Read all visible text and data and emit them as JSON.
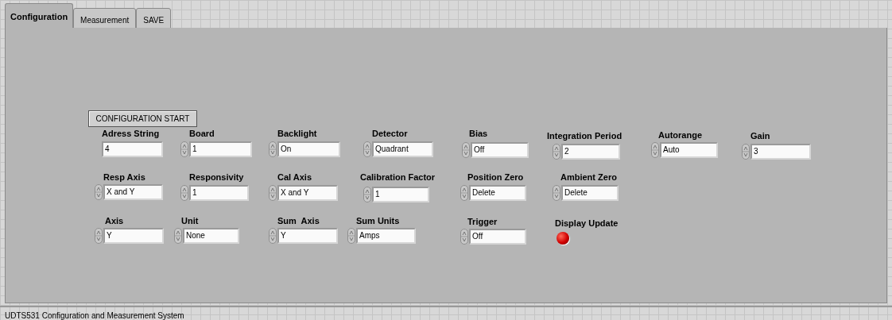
{
  "tabs": [
    {
      "label": "Configuration",
      "selected": true
    },
    {
      "label": "Measurement",
      "selected": false
    },
    {
      "label": "SAVE",
      "selected": false
    }
  ],
  "start_button": "CONFIGURATION START",
  "controls": [
    {
      "kind": "string",
      "label": "Adress String",
      "value": "4"
    },
    {
      "kind": "ring",
      "label": "Board",
      "value": "1"
    },
    {
      "kind": "ring",
      "label": "Backlight",
      "value": "On"
    },
    {
      "kind": "ring",
      "label": "Detector",
      "value": "Quadrant"
    },
    {
      "kind": "ring",
      "label": "Bias",
      "value": "Off"
    },
    {
      "kind": "ring",
      "label": "Integration Period",
      "value": "2"
    },
    {
      "kind": "ring",
      "label": "Autorange",
      "value": "Auto"
    },
    {
      "kind": "ring",
      "label": "Gain",
      "value": "3"
    },
    {
      "kind": "ring",
      "label": "Resp Axis",
      "value": "X and Y"
    },
    {
      "kind": "ring",
      "label": "Responsivity",
      "value": "1"
    },
    {
      "kind": "ring",
      "label": "Cal Axis",
      "value": "X and Y"
    },
    {
      "kind": "ring",
      "label": "Calibration Factor",
      "value": "1"
    },
    {
      "kind": "ring",
      "label": "Position Zero",
      "value": "Delete"
    },
    {
      "kind": "ring",
      "label": "Ambient Zero",
      "value": "Delete"
    },
    {
      "kind": "ring",
      "label": "Axis",
      "value": "Y"
    },
    {
      "kind": "ring",
      "label": "Unit",
      "value": "None"
    },
    {
      "kind": "ring",
      "label": "Sum  Axis",
      "value": "Y"
    },
    {
      "kind": "ring",
      "label": "Sum Units",
      "value": "Amps"
    },
    {
      "kind": "ring",
      "label": "Trigger",
      "value": "Off"
    },
    {
      "kind": "led",
      "label": "Display Update",
      "on": true
    }
  ],
  "status_bar": "UDTS531 Configuration and Measurement System"
}
